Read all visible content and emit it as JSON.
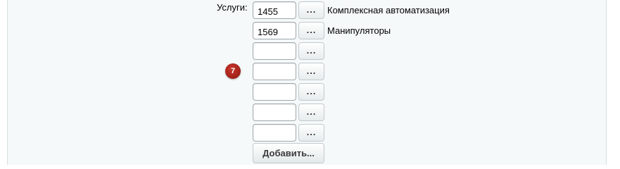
{
  "form": {
    "services_label": "Услуги:",
    "badge": "7",
    "browse_label": "...",
    "add_button_label": "Добавить...",
    "rows": [
      {
        "id": "1455",
        "name": "Комплексная автоматизация"
      },
      {
        "id": "1569",
        "name": "Манипуляторы"
      },
      {
        "id": "",
        "name": ""
      },
      {
        "id": "",
        "name": ""
      },
      {
        "id": "",
        "name": ""
      },
      {
        "id": "",
        "name": ""
      },
      {
        "id": "",
        "name": ""
      }
    ]
  }
}
